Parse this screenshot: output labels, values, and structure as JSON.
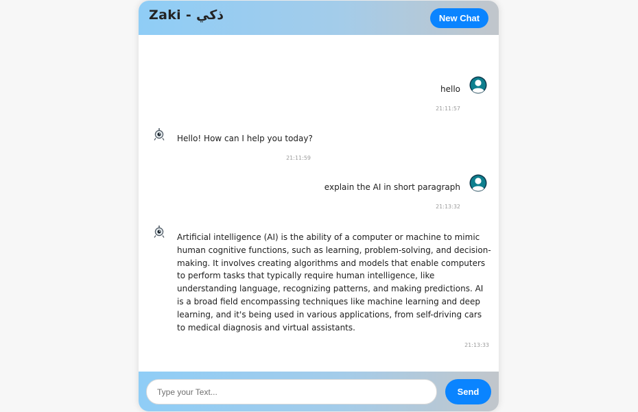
{
  "header": {
    "title": "Zaki - ذكي",
    "new_chat_label": "New Chat"
  },
  "colors": {
    "accent": "#0a84ff",
    "header_gradient_start": "#8fcdf6",
    "header_gradient_end": "#c1c6cb",
    "avatar_teal": "#0e7f8e",
    "avatar_dark": "#0f3a4d"
  },
  "messages": [
    {
      "sender": "user",
      "avatar": "user-avatar",
      "text": "hello",
      "time": "21:11:57"
    },
    {
      "sender": "bot",
      "avatar": "bot-icon",
      "text": "Hello! How can I help you today?",
      "time": "21:11:59"
    },
    {
      "sender": "user",
      "avatar": "user-avatar",
      "text": "explain the AI in short paragraph",
      "time": "21:13:32"
    },
    {
      "sender": "bot",
      "avatar": "bot-icon",
      "text": "Artificial intelligence (AI) is the ability of a computer or machine to mimic human cognitive functions, such as learning, problem-solving, and decision-making. It involves creating algorithms and models that enable computers to perform tasks that typically require human intelligence, like understanding language, recognizing patterns, and making predictions. AI is a broad field encompassing techniques like machine learning and deep learning, and it's being used in various applications, from self-driving cars to medical diagnosis and virtual assistants.",
      "time": "21:13:33"
    }
  ],
  "composer": {
    "placeholder": "Type your Text...",
    "value": "",
    "send_label": "Send"
  }
}
